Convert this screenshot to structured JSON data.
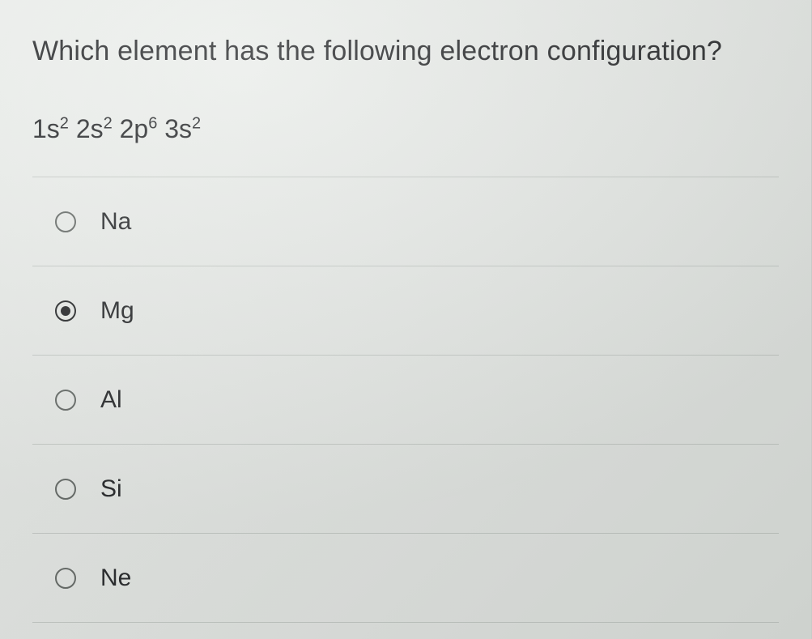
{
  "question": {
    "prompt": "Which element has the following electron configuration?",
    "configuration_terms": [
      {
        "base": "1s",
        "sup": "2"
      },
      {
        "base": "2s",
        "sup": "2"
      },
      {
        "base": "2p",
        "sup": "6"
      },
      {
        "base": "3s",
        "sup": "2"
      }
    ]
  },
  "options": [
    {
      "label": "Na",
      "selected": false
    },
    {
      "label": "Mg",
      "selected": true
    },
    {
      "label": "Al",
      "selected": false
    },
    {
      "label": "Si",
      "selected": false
    },
    {
      "label": "Ne",
      "selected": false
    }
  ]
}
